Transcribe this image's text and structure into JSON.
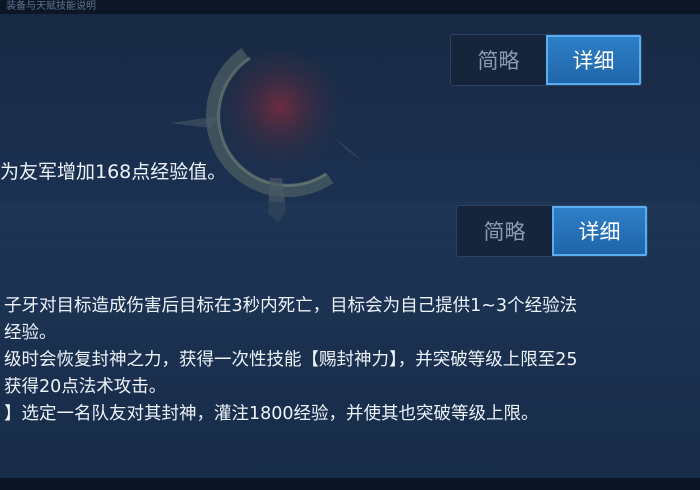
{
  "header": {
    "faded_title": "装备与天赋技能说明"
  },
  "section1": {
    "toggle": {
      "brief": "简略",
      "detail": "详细",
      "selected": "detail"
    },
    "text": "为友军增加168点经验值。"
  },
  "section2": {
    "toggle": {
      "brief": "简略",
      "detail": "详细",
      "selected": "detail"
    },
    "lines": [
      "子牙对目标造成伤害后目标在3秒内死亡，目标会为自己提供1~3个经验法",
      "经验。",
      "级时会恢复封神之力，获得一次性技能【赐封神力】，并突破等级上限至25",
      "获得20点法术攻击。",
      "】选定一名队友对其封神，灌注1800经验，并使其也突破等级上限。"
    ]
  },
  "colors": {
    "accent": "#2f80c8",
    "accent_border": "#58aef0",
    "bg": "#1a2f4e",
    "text": "#eef3fa"
  }
}
